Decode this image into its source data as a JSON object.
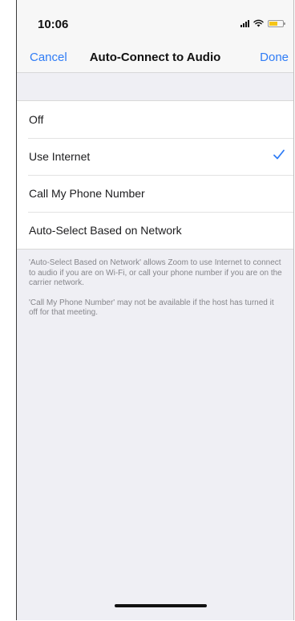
{
  "status_bar": {
    "time": "10:06",
    "icons": [
      "signal-icon",
      "wifi-icon",
      "battery-icon"
    ],
    "battery_color": "#f5c518"
  },
  "nav": {
    "cancel_label": "Cancel",
    "title": "Auto-Connect to Audio",
    "done_label": "Done",
    "accent_color": "#2f7cf6"
  },
  "options": [
    {
      "label": "Off",
      "selected": false
    },
    {
      "label": "Use Internet",
      "selected": true
    },
    {
      "label": "Call My Phone Number",
      "selected": false
    },
    {
      "label": "Auto-Select Based on Network",
      "selected": false
    }
  ],
  "notes": {
    "note_1": "'Auto-Select Based on Network' allows Zoom to use Internet to connect to audio if you are on Wi-Fi, or call your phone number if you are on the carrier network.",
    "note_2": "'Call My Phone Number' may not be available if the host has turned it off for that meeting."
  }
}
